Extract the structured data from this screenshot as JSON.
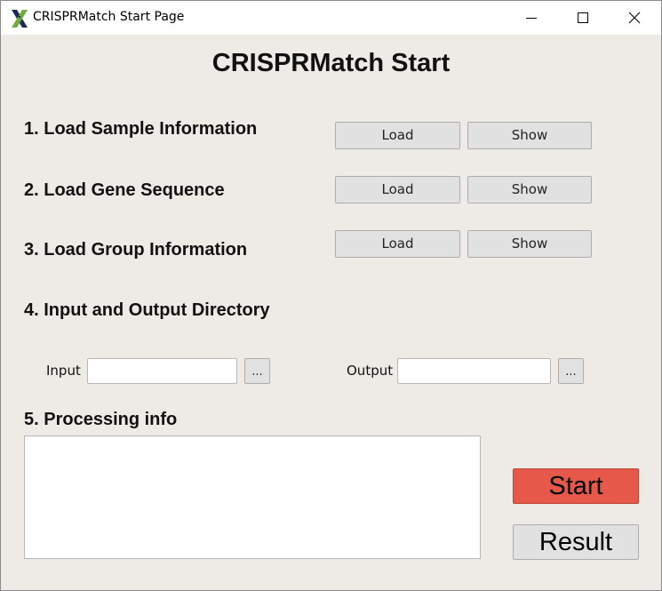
{
  "window": {
    "title": "CRISPRMatch Start Page",
    "controls": {
      "minimize": "minimize-icon",
      "maximize": "maximize-icon",
      "close": "close-icon"
    }
  },
  "heading": "CRISPRMatch Start",
  "sections": [
    {
      "label": "1. Load Sample Information",
      "load": "Load",
      "show": "Show"
    },
    {
      "label": "2. Load Gene Sequence",
      "load": "Load",
      "show": "Show"
    },
    {
      "label": "3. Load Group Information",
      "load": "Load",
      "show": "Show"
    },
    {
      "label": "4. Input and Output Directory"
    }
  ],
  "io": {
    "input_label": "Input",
    "input_value": "",
    "input_browse": "...",
    "output_label": "Output",
    "output_value": "",
    "output_browse": "..."
  },
  "processing": {
    "label": "5. Processing info",
    "text": ""
  },
  "actions": {
    "start": "Start",
    "result": "Result"
  },
  "colors": {
    "start_button": "#e6584a",
    "background": "#eeebe7"
  }
}
